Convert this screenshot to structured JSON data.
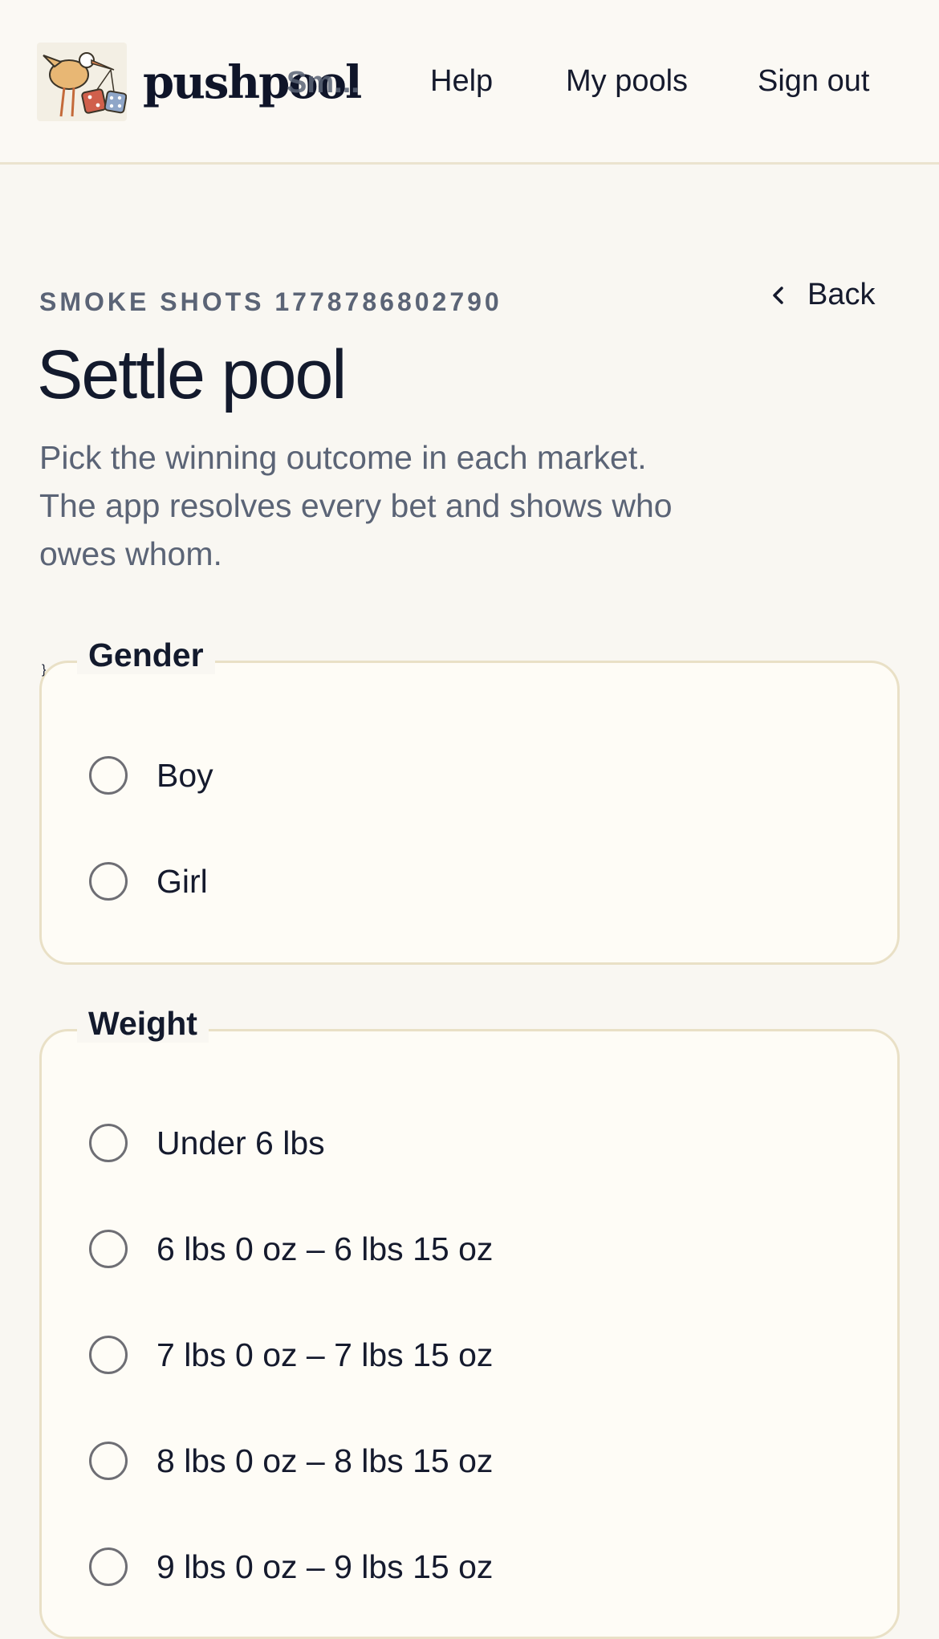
{
  "header": {
    "logo_text": "pushpool",
    "logo_overlay_text": "Sm...",
    "logo_icon": "stork-with-dice-logo",
    "nav": {
      "help": "Help",
      "my_pools": "My pools",
      "sign_out": "Sign out"
    }
  },
  "page": {
    "eyebrow": "SMOKE SHOTS 1778786802790",
    "back_label": "Back",
    "title": "Settle pool",
    "description": "Pick the winning outcome in each market. The app resolves every bet and shows who owes whom."
  },
  "markets": {
    "gender": {
      "legend": "Gender",
      "options": [
        "Boy",
        "Girl"
      ]
    },
    "weight": {
      "legend": "Weight",
      "options": [
        "Under 6 lbs",
        "6 lbs 0 oz – 6 lbs 15 oz",
        "7 lbs 0 oz – 7 lbs 15 oz",
        "8 lbs 0 oz – 8 lbs 15 oz",
        "9 lbs 0 oz – 9 lbs 15 oz"
      ]
    }
  },
  "colors": {
    "page_bg": "#f9f7f2",
    "card_border": "#e9e0c6",
    "text_primary": "#141a2e",
    "text_muted": "#5b6476"
  }
}
